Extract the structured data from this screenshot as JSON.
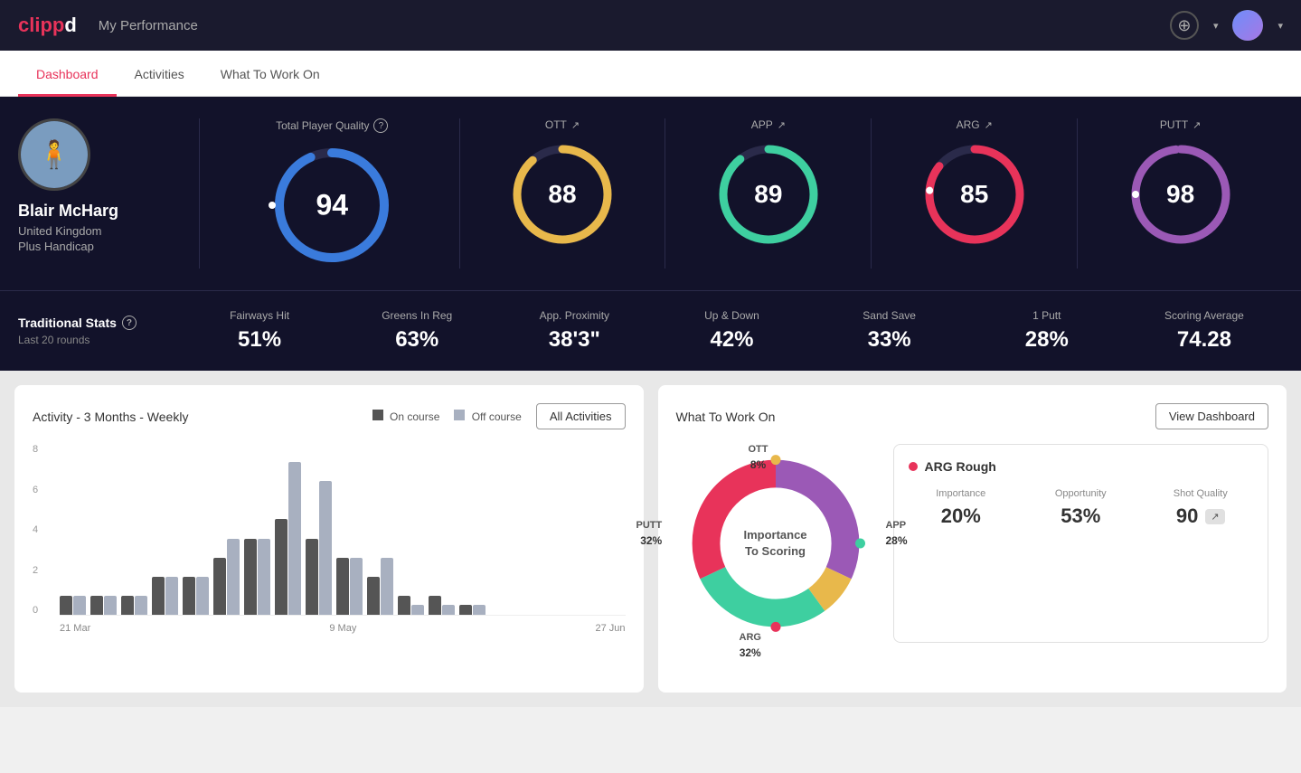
{
  "app": {
    "logo": "clippd",
    "logo_colored": "clipp",
    "logo_suffix": "d"
  },
  "header": {
    "title": "My Performance",
    "add_icon": "+",
    "dropdown_arrow": "▾"
  },
  "nav": {
    "tabs": [
      {
        "label": "Dashboard",
        "active": true
      },
      {
        "label": "Activities",
        "active": false
      },
      {
        "label": "What To Work On",
        "active": false
      }
    ]
  },
  "profile": {
    "name": "Blair McHarg",
    "country": "United Kingdom",
    "handicap": "Plus Handicap"
  },
  "quality_scores": {
    "total": {
      "label": "Total Player Quality",
      "value": 94,
      "color": "#3a7bdc"
    },
    "ott": {
      "label": "OTT",
      "value": 88,
      "color": "#e8b84b"
    },
    "app": {
      "label": "APP",
      "value": 89,
      "color": "#3ecfa0"
    },
    "arg": {
      "label": "ARG",
      "value": 85,
      "color": "#e8335a"
    },
    "putt": {
      "label": "PUTT",
      "value": 98,
      "color": "#9b59b6"
    }
  },
  "traditional_stats": {
    "label": "Traditional Stats",
    "sublabel": "Last 20 rounds",
    "stats": [
      {
        "name": "Fairways Hit",
        "value": "51%"
      },
      {
        "name": "Greens In Reg",
        "value": "63%"
      },
      {
        "name": "App. Proximity",
        "value": "38'3\""
      },
      {
        "name": "Up & Down",
        "value": "42%"
      },
      {
        "name": "Sand Save",
        "value": "33%"
      },
      {
        "name": "1 Putt",
        "value": "28%"
      },
      {
        "name": "Scoring Average",
        "value": "74.28"
      }
    ]
  },
  "activity_chart": {
    "title": "Activity - 3 Months - Weekly",
    "legend": {
      "on_course": "On course",
      "off_course": "Off course"
    },
    "all_activities_btn": "All Activities",
    "x_labels": [
      "21 Mar",
      "9 May",
      "27 Jun"
    ],
    "y_labels": [
      "8",
      "6",
      "4",
      "2",
      "0"
    ],
    "bars": [
      {
        "on": 1,
        "off": 1
      },
      {
        "on": 1,
        "off": 1
      },
      {
        "on": 1,
        "off": 1
      },
      {
        "on": 2,
        "off": 2
      },
      {
        "on": 2,
        "off": 2
      },
      {
        "on": 3,
        "off": 4
      },
      {
        "on": 4,
        "off": 4
      },
      {
        "on": 5,
        "off": 8
      },
      {
        "on": 4,
        "off": 7
      },
      {
        "on": 3,
        "off": 3
      },
      {
        "on": 2,
        "off": 3
      },
      {
        "on": 1,
        "off": 0.5
      },
      {
        "on": 1,
        "off": 0.5
      },
      {
        "on": 0.5,
        "off": 0.5
      }
    ]
  },
  "what_to_work_on": {
    "title": "What To Work On",
    "view_dashboard_btn": "View Dashboard",
    "donut": {
      "center_label": "Importance\nTo Scoring",
      "segments": [
        {
          "label": "OTT",
          "pct": "8%",
          "color": "#e8b84b",
          "value": 8
        },
        {
          "label": "APP",
          "pct": "28%",
          "color": "#3ecfa0",
          "value": 28
        },
        {
          "label": "ARG",
          "pct": "32%",
          "color": "#e8335a",
          "value": 32
        },
        {
          "label": "PUTT",
          "pct": "32%",
          "color": "#9b59b6",
          "value": 32
        }
      ]
    },
    "detail": {
      "title": "ARG Rough",
      "dot_color": "#e8335a",
      "importance": "20%",
      "opportunity": "53%",
      "shot_quality": "90",
      "labels": {
        "importance": "Importance",
        "opportunity": "Opportunity",
        "shot_quality": "Shot Quality"
      }
    }
  }
}
